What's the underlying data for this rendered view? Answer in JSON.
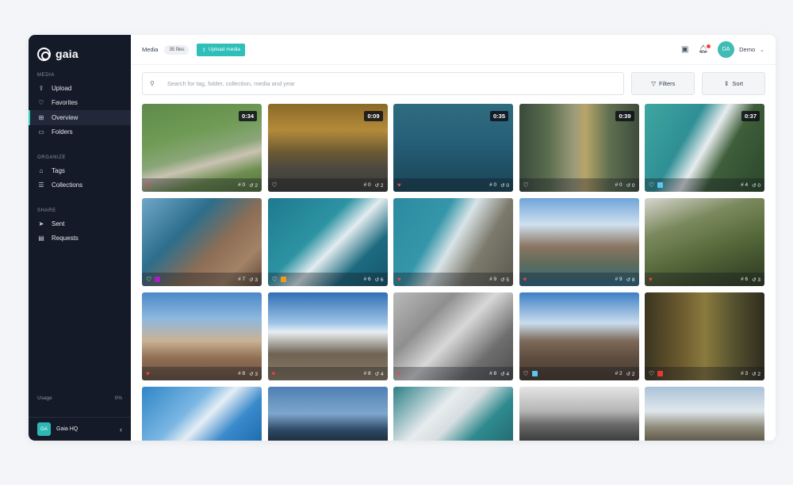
{
  "app": {
    "brand": "gaia"
  },
  "sidebar": {
    "sections": [
      {
        "label": "MEDIA",
        "items": [
          {
            "label": "Upload",
            "icon": "upload-icon",
            "glyph": "⇪",
            "active": false
          },
          {
            "label": "Favorites",
            "icon": "heart-icon",
            "glyph": "♡",
            "active": false
          },
          {
            "label": "Overview",
            "icon": "grid-icon",
            "glyph": "⊞",
            "active": true
          },
          {
            "label": "Folders",
            "icon": "folder-icon",
            "glyph": "▭",
            "active": false
          }
        ]
      },
      {
        "label": "ORGANIZE",
        "items": [
          {
            "label": "Tags",
            "icon": "tag-icon",
            "glyph": "⌂",
            "active": false
          },
          {
            "label": "Collections",
            "icon": "list-icon",
            "glyph": "☰",
            "active": false
          }
        ]
      },
      {
        "label": "SHARE",
        "items": [
          {
            "label": "Sent",
            "icon": "send-icon",
            "glyph": "➤",
            "active": false
          },
          {
            "label": "Requests",
            "icon": "document-icon",
            "glyph": "▤",
            "active": false
          }
        ]
      }
    ],
    "usage": {
      "label": "Usage",
      "value": "0%"
    },
    "workspace": {
      "initials": "GA",
      "name": "Gaia HQ",
      "chevron": "‹"
    }
  },
  "topbar": {
    "crumb": "Media",
    "count": "35 files",
    "upload_label": "Upload media",
    "upload_glyph": "⇪",
    "calendar_glyph": "▣",
    "bell_glyph": "🔔︎",
    "user": {
      "initials": "DA",
      "name": "Demo",
      "chevron": "⌄"
    }
  },
  "search": {
    "placeholder": "Search for tag, folder, collection, media and year",
    "glyph": "⚲"
  },
  "filters_label": "Filters",
  "filters_glyph": "▽",
  "sort_label": "Sort",
  "sort_glyph": "⇕",
  "colors": {
    "accent": "#2dbfb8",
    "sidebar": "#151a28",
    "favorite": "#ef4444"
  },
  "tiles": [
    {
      "duration": "0:34",
      "fav": true,
      "swatch": null,
      "tags": "0",
      "history": "2",
      "bg": "linear-gradient(165deg,#5f8a4a 0%,#6f9b55 35%,#8aa678 55%,#c9c3b2 65%,#6e8e50 80%,#4e6e39 100%)"
    },
    {
      "duration": "0:09",
      "fav": false,
      "swatch": null,
      "tags": "0",
      "history": "2",
      "bg": "linear-gradient(180deg,#8a6a28 0%,#b48a3a 30%,#6a5a33 55%,#4b4740 75%,#3b3a36 100%)"
    },
    {
      "duration": "0:35",
      "fav": true,
      "swatch": null,
      "tags": "0",
      "history": "0",
      "bg": "linear-gradient(180deg,#2f6c7e 0%,#27607a 40%,#1e4f63 75%,#1b4556 100%)"
    },
    {
      "duration": "0:39",
      "fav": false,
      "swatch": null,
      "tags": "0",
      "history": "0",
      "bg": "linear-gradient(90deg,#3a4a3c 0%,#5c6e4f 25%,#9a9a7a 45%,#b8a56a 55%,#5f7050 75%,#3e4c3c 100%)"
    },
    {
      "duration": "0:37",
      "fav": false,
      "swatch": "#5bc8f0",
      "tags": "4",
      "history": "0",
      "bg": "linear-gradient(120deg,#3fa6a0 0%,#2f8f95 35%,#e8ecee 50%,#3e5f3a 65%,#2b472b 100%)"
    },
    {
      "duration": null,
      "fav": false,
      "swatch": "#a320c8",
      "tags": "7",
      "history": "3",
      "bg": "linear-gradient(135deg,#6fa7c9 0%,#2d6e8c 35%,#8c6e56 60%,#a38266 80%,#5e4a3a 100%)"
    },
    {
      "duration": null,
      "fav": false,
      "swatch": "#f29a1e",
      "tags": "6",
      "history": "6",
      "bg": "linear-gradient(135deg,#1f7a8f 0%,#2c93a3 40%,#e2ecef 55%,#1d6b80 75%,#15566a 100%)"
    },
    {
      "duration": null,
      "fav": true,
      "swatch": null,
      "tags": "9",
      "history": "5",
      "bg": "linear-gradient(120deg,#2b8aa0 0%,#3596a9 35%,#d9e4e7 50%,#7c7a6c 70%,#5b5a50 100%)"
    },
    {
      "duration": null,
      "fav": true,
      "swatch": null,
      "tags": "9",
      "history": "8",
      "bg": "linear-gradient(180deg,#6fa4d9 0%,#cfe0ee 30%,#8a7562 55%,#5e6b5a 75%,#2f6f8a 100%)"
    },
    {
      "duration": null,
      "fav": true,
      "swatch": null,
      "tags": "6",
      "history": "3",
      "bg": "linear-gradient(160deg,#d8d6cf 0%,#7b8a5e 30%,#5a6d3d 55%,#3f4e2c 80%,#2f3b22 100%)"
    },
    {
      "duration": null,
      "fav": true,
      "swatch": null,
      "tags": "8",
      "history": "3",
      "bg": "linear-gradient(180deg,#4a88c9 0%,#8fb8df 30%,#c9b295 55%,#8f6d52 75%,#6a5342 100%)"
    },
    {
      "duration": null,
      "fav": true,
      "swatch": null,
      "tags": "8",
      "history": "4",
      "bg": "linear-gradient(180deg,#2f6fb5 0%,#9ec4e6 35%,#e9eef2 45%,#6f6354 70%,#8a7a62 100%)"
    },
    {
      "duration": null,
      "fav": true,
      "swatch": null,
      "tags": "8",
      "history": "4",
      "bg": "linear-gradient(135deg,#b9b9b9 0%,#8f8f8f 30%,#d8d8d8 50%,#6e6e6e 75%,#4c4c4c 100%)"
    },
    {
      "duration": null,
      "fav": false,
      "swatch": "#5bc8f0",
      "tags": "2",
      "history": "2",
      "bg": "linear-gradient(180deg,#3d7fc4 0%,#c9dced 35%,#7d6a5a 55%,#5e4c3e 75%,#4a3b30 100%)"
    },
    {
      "duration": null,
      "fav": false,
      "swatch": "#e53935",
      "tags": "3",
      "history": "2",
      "bg": "linear-gradient(90deg,#3a3420 0%,#6b5a2e 30%,#8a7a3e 50%,#55512f 75%,#2f2c1e 100%)"
    },
    {
      "duration": null,
      "fav": false,
      "swatch": null,
      "tags": null,
      "history": null,
      "bg": "linear-gradient(135deg,#2f86c8 0%,#7ab6e2 40%,#e6eef5 55%,#3a8acb 75%,#1e6db0 100%)"
    },
    {
      "duration": null,
      "fav": false,
      "swatch": null,
      "tags": null,
      "history": null,
      "bg": "linear-gradient(180deg,#4e80b4 0%,#7ea6cd 50%,#2e4a66 80%,#1f2f42 100%)"
    },
    {
      "duration": null,
      "fav": false,
      "swatch": null,
      "tags": null,
      "history": null,
      "bg": "linear-gradient(135deg,#2b7f86 0%,#e8ecee 40%,#d5dde0 55%,#2f8a8f 75%,#236d73 100%)"
    },
    {
      "duration": null,
      "fav": false,
      "swatch": null,
      "tags": null,
      "history": null,
      "bg": "linear-gradient(180deg,#e5e5e5 0%,#b5b5b5 45%,#6a6a6a 70%,#3d3d3d 100%)"
    },
    {
      "duration": null,
      "fav": false,
      "swatch": null,
      "tags": null,
      "history": null,
      "bg": "linear-gradient(180deg,#aac3d8 0%,#e0e7ec 45%,#8f8b7a 75%,#5f5a4b 100%)"
    }
  ]
}
